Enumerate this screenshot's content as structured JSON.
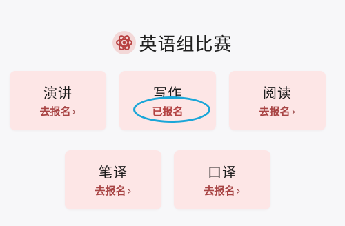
{
  "header": {
    "title": "英语组比赛",
    "icon": "atom-icon",
    "icon_color": "#b84242"
  },
  "cards": [
    {
      "title": "演讲",
      "action": "去报名",
      "chevron": "›",
      "registered": false
    },
    {
      "title": "写作",
      "action": "已报名",
      "registered": true
    },
    {
      "title": "阅读",
      "action": "去报名",
      "chevron": "›",
      "registered": false
    },
    {
      "title": "笔译",
      "action": "去报名",
      "chevron": "›",
      "registered": false
    },
    {
      "title": "口译",
      "action": "去报名",
      "chevron": "›",
      "registered": false
    }
  ],
  "colors": {
    "card_bg": "#fde6e6",
    "action_text": "#a84444",
    "highlight_ring": "#1aa6d8"
  }
}
